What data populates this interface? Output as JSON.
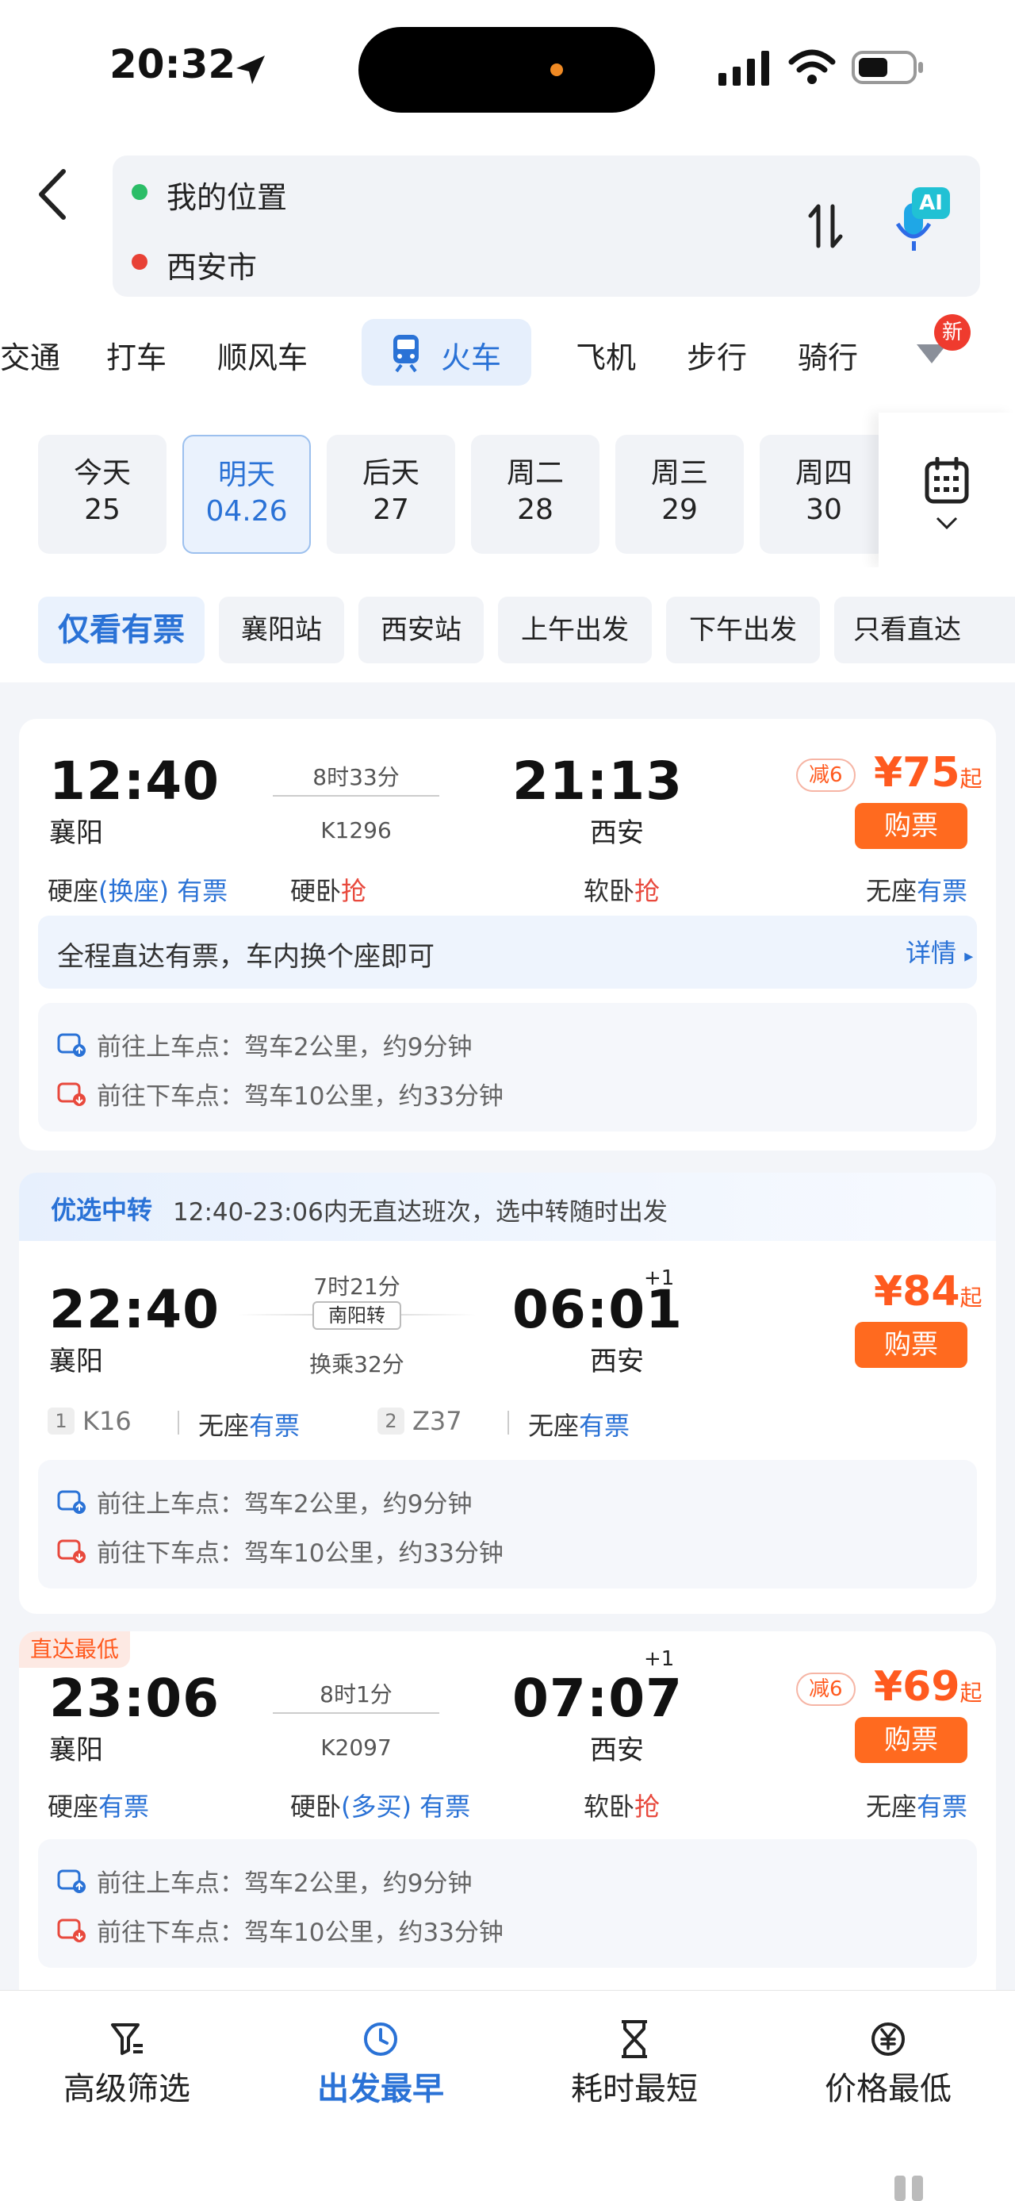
{
  "status": {
    "time": "20:32"
  },
  "search": {
    "from": "我的位置",
    "to": "西安市",
    "ai_badge": "AI"
  },
  "modes": [
    {
      "label": "交通"
    },
    {
      "label": "打车"
    },
    {
      "label": "顺风车"
    },
    {
      "label": "火车"
    },
    {
      "label": "飞机"
    },
    {
      "label": "步行"
    },
    {
      "label": "骑行"
    }
  ],
  "new_badge": "新",
  "dates": [
    {
      "day": "今天",
      "date": "25"
    },
    {
      "day": "明天",
      "date": "04.26"
    },
    {
      "day": "后天",
      "date": "27"
    },
    {
      "day": "周二",
      "date": "28"
    },
    {
      "day": "周三",
      "date": "29"
    },
    {
      "day": "周四",
      "date": "30"
    }
  ],
  "filters": [
    "仅看有票",
    "襄阳站",
    "西安站",
    "上午出发",
    "下午出发",
    "只看直达"
  ],
  "train1": {
    "dep_time": "12:40",
    "dep_city": "襄阳",
    "duration": "8时33分",
    "number": "K1296",
    "arr_time": "21:13",
    "arr_city": "西安",
    "coupon": "减6",
    "price": "¥75",
    "price_suffix": "起",
    "buy": "购票",
    "seat1_a": "硬座",
    "seat1_b": "(换座)",
    "seat1_c": "有票",
    "seat2_a": "硬卧",
    "seat2_b": "抢",
    "seat3_a": "软卧",
    "seat3_b": "抢",
    "seat4_a": "无座",
    "seat4_b": "有票",
    "tip": "全程直达有票，车内换个座即可",
    "tip_link": "详情",
    "route_up": "前往上车点：驾车2公里，约9分钟",
    "route_down": "前往下车点：驾车10公里，约33分钟"
  },
  "transfer": {
    "tag": "优选中转",
    "note": "12:40-23:06内无直达班次，选中转随时出发",
    "dep_time": "22:40",
    "dep_city": "襄阳",
    "duration": "7时21分",
    "via": "南阳转",
    "wait": "换乘32分",
    "arr_time": "06:01",
    "arr_city": "西安",
    "plus": "+1",
    "price": "¥84",
    "price_suffix": "起",
    "buy": "购票",
    "leg1_no": "1",
    "leg1_train": "K16",
    "leg1_seat": "无座",
    "leg1_status": "有票",
    "leg2_no": "2",
    "leg2_train": "Z37",
    "leg2_seat": "无座",
    "leg2_status": "有票",
    "route_up": "前往上车点：驾车2公里，约9分钟",
    "route_down": "前往下车点：驾车10公里，约33分钟"
  },
  "train3": {
    "badge": "直达最低",
    "dep_time": "23:06",
    "dep_city": "襄阳",
    "duration": "8时1分",
    "number": "K2097",
    "arr_time": "07:07",
    "arr_city": "西安",
    "plus": "+1",
    "coupon": "减6",
    "price": "¥69",
    "price_suffix": "起",
    "buy": "购票",
    "seat1_a": "硬座",
    "seat1_b": "有票",
    "seat2_a": "硬卧",
    "seat2_b": "(多买)",
    "seat2_c": "有票",
    "seat3_a": "软卧",
    "seat3_b": "抢",
    "seat4_a": "无座",
    "seat4_b": "有票",
    "route_up": "前往上车点：驾车2公里，约9分钟",
    "route_down": "前往下车点：驾车10公里，约33分钟"
  },
  "bottom": [
    {
      "label": "高级筛选"
    },
    {
      "label": "出发最早"
    },
    {
      "label": "耗时最短"
    },
    {
      "label": "价格最低"
    }
  ],
  "colors": {
    "accent": "#2a72d6",
    "orange": "#ff6a1f",
    "red": "#e8493d"
  }
}
